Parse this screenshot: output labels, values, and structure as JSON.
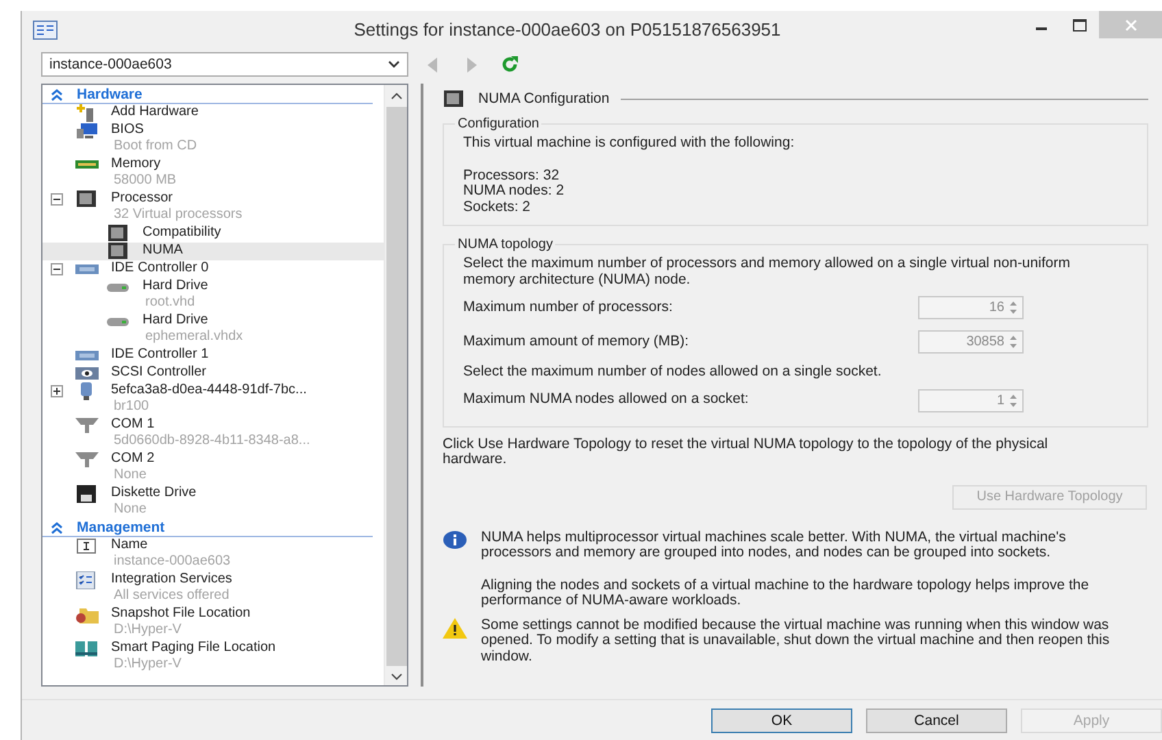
{
  "window": {
    "title": "Settings for instance-000ae603 on P05151876563951"
  },
  "toolbar": {
    "vm_select": "instance-000ae603",
    "nav": [
      {
        "kind": "back",
        "disabled": true
      },
      {
        "kind": "forward",
        "disabled": true
      },
      {
        "kind": "refresh",
        "disabled": false
      }
    ]
  },
  "sidebar": {
    "sections": [
      {
        "title": "Hardware",
        "expanded": true,
        "items": [
          {
            "kind": "add",
            "label": "Add Hardware",
            "selected": false
          },
          {
            "kind": "bios",
            "label": "BIOS",
            "detail": "Boot from CD",
            "selected": false
          },
          {
            "kind": "memory",
            "label": "Memory",
            "detail": "58000 MB",
            "selected": false
          },
          {
            "kind": "processor",
            "label": "Processor",
            "detail": "32 Virtual processors",
            "selected": false,
            "expanded": true,
            "children": [
              {
                "kind": "processor",
                "label": "Compatibility",
                "selected": false
              },
              {
                "kind": "processor",
                "label": "NUMA",
                "selected": true
              }
            ]
          },
          {
            "kind": "controller",
            "label": "IDE Controller 0",
            "selected": false,
            "expanded": true,
            "children": [
              {
                "kind": "drive",
                "label": "Hard Drive",
                "detail": "root.vhd",
                "selected": false
              },
              {
                "kind": "drive",
                "label": "Hard Drive",
                "detail": "ephemeral.vhdx",
                "selected": false
              }
            ]
          },
          {
            "kind": "controller",
            "label": "IDE Controller 1",
            "selected": false
          },
          {
            "kind": "scsi",
            "label": "SCSI Controller",
            "selected": false
          },
          {
            "kind": "network",
            "label": "5efca3a8-d0ea-4448-91df-7bc...",
            "detail": "br100",
            "selected": false,
            "expanded": false
          },
          {
            "kind": "com",
            "label": "COM 1",
            "detail": "5d0660db-8928-4b11-8348-a8...",
            "selected": false
          },
          {
            "kind": "com",
            "label": "COM 2",
            "detail": "None",
            "selected": false
          },
          {
            "kind": "floppy",
            "label": "Diskette Drive",
            "detail": "None",
            "selected": false
          }
        ]
      },
      {
        "title": "Management",
        "expanded": true,
        "items": [
          {
            "kind": "name",
            "label": "Name",
            "detail": "instance-000ae603",
            "selected": false
          },
          {
            "kind": "integration",
            "label": "Integration Services",
            "detail": "All services offered",
            "selected": false
          },
          {
            "kind": "folder",
            "label": "Snapshot File Location",
            "detail": "D:\\Hyper-V",
            "selected": false
          },
          {
            "kind": "paging",
            "label": "Smart Paging File Location",
            "detail": "D:\\Hyper-V",
            "selected": false
          }
        ]
      }
    ]
  },
  "panel": {
    "title": "NUMA Configuration",
    "configuration": {
      "title": "Configuration",
      "intro": "This virtual machine is configured with the following:",
      "lines": [
        "Processors: 32",
        "NUMA nodes: 2",
        "Sockets: 2"
      ]
    },
    "topology": {
      "title": "NUMA topology",
      "rows": [
        {
          "kind": "text",
          "text": "Select the maximum number of processors and memory allowed on a single virtual non-uniform memory architecture (NUMA) node."
        },
        {
          "kind": "spinner",
          "label": "Maximum number of processors:",
          "value": "16",
          "disabled": true
        },
        {
          "kind": "spinner",
          "label": "Maximum amount of memory (MB):",
          "value": "30858",
          "disabled": true
        },
        {
          "kind": "text",
          "text": "Select the maximum number of nodes allowed on a single socket."
        },
        {
          "kind": "spinner",
          "label": "Maximum NUMA nodes allowed on a socket:",
          "value": "1",
          "disabled": true
        }
      ]
    },
    "reset_note": "Click Use Hardware Topology to reset the virtual NUMA topology to the topology of the physical hardware.",
    "reset_button": {
      "label": "Use Hardware Topology",
      "disabled": true
    },
    "notes": [
      {
        "kind": "info",
        "paragraphs": [
          "NUMA helps multiprocessor virtual machines scale better.  With NUMA, the virtual machine's processors and memory are grouped into nodes, and nodes can be grouped into sockets.",
          "Aligning the nodes and sockets of a virtual machine to the hardware topology helps improve the performance of NUMA-aware workloads."
        ]
      },
      {
        "kind": "warning",
        "paragraphs": [
          "Some settings cannot be modified because the virtual machine was running when this window was opened. To modify a setting that is unavailable, shut down the virtual machine and then reopen this window."
        ]
      }
    ]
  },
  "buttons": [
    {
      "label": "OK",
      "default": true,
      "disabled": false
    },
    {
      "label": "Cancel",
      "default": false,
      "disabled": false
    },
    {
      "label": "Apply",
      "default": false,
      "disabled": true
    }
  ]
}
